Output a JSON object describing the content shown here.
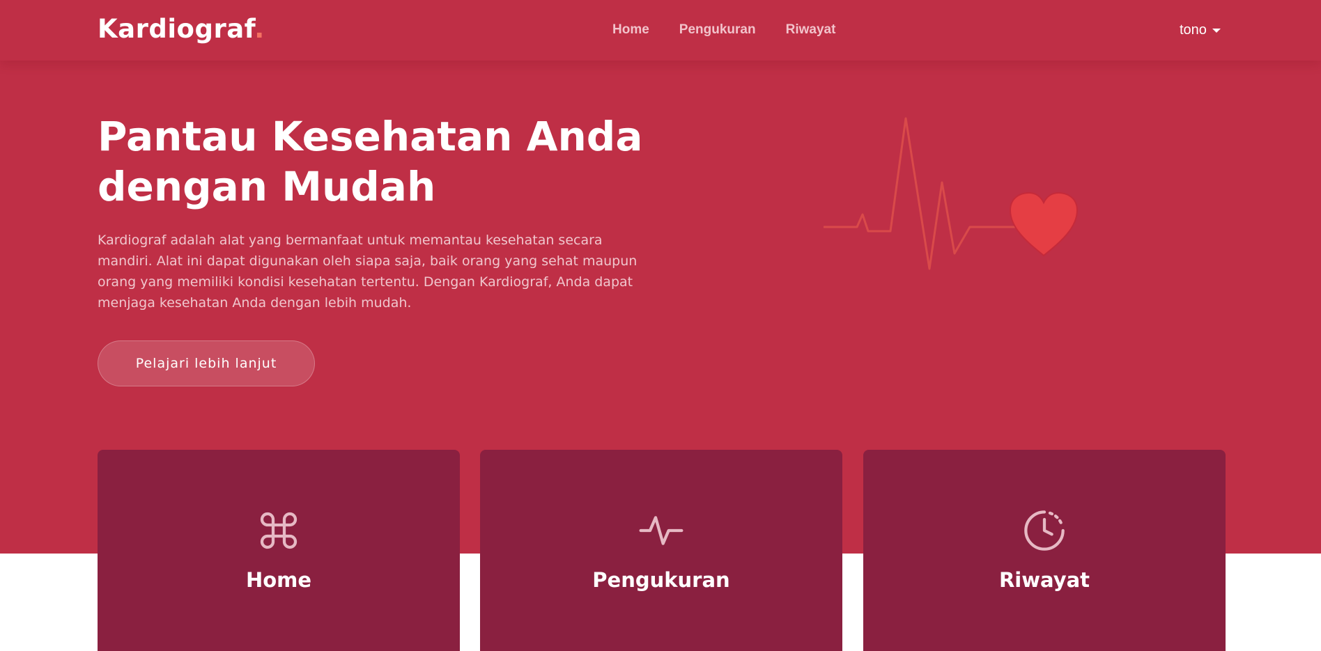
{
  "navbar": {
    "brand": "Kardiograf",
    "brand_dot": ".",
    "links": [
      "Home",
      "Pengukuran",
      "Riwayat"
    ],
    "user": "tono"
  },
  "hero": {
    "title": "Pantau Kesehatan Anda dengan Mudah",
    "description": "Kardiograf adalah alat yang bermanfaat untuk memantau kesehatan secara mandiri. Alat ini dapat digunakan oleh siapa saja, baik orang yang sehat maupun orang yang memiliki kondisi kesehatan tertentu. Dengan Kardiograf, Anda dapat menjaga kesehatan Anda dengan lebih mudah.",
    "cta_label": "Pelajari lebih lanjut"
  },
  "cards": [
    {
      "title": "Home",
      "icon": "command-icon"
    },
    {
      "title": "Pengukuran",
      "icon": "activity-icon"
    },
    {
      "title": "Riwayat",
      "icon": "clock-icon"
    }
  ],
  "colors": {
    "primary": "#bf2f46",
    "card": "#8a2040",
    "accent_dot": "#f47162",
    "heart": "#e53e44",
    "nav_link": "#f2c3cb"
  }
}
